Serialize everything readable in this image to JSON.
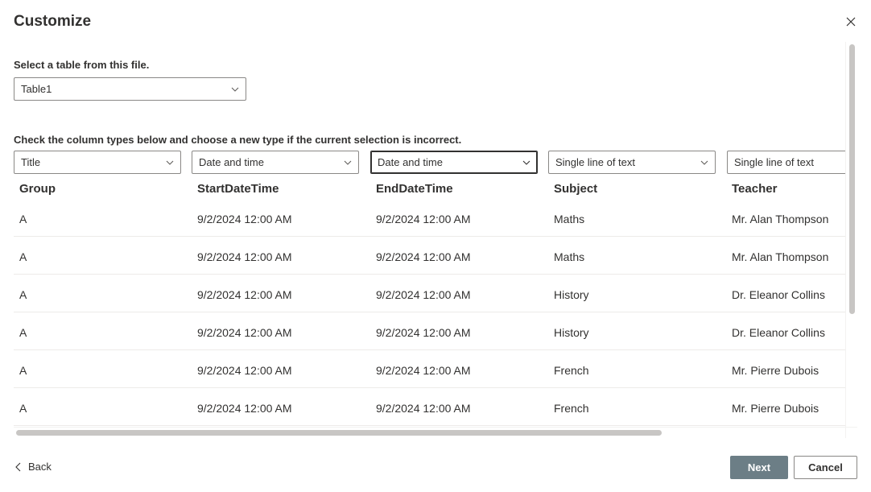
{
  "dialog": {
    "title": "Customize",
    "close_icon": "close-icon"
  },
  "table_picker": {
    "label": "Select a table from this file.",
    "selected": "Table1"
  },
  "columns_section": {
    "label": "Check the column types below and choose a new type if the current selection is incorrect."
  },
  "columns": [
    {
      "header": "Group",
      "type": "Title"
    },
    {
      "header": "StartDateTime",
      "type": "Date and time"
    },
    {
      "header": "EndDateTime",
      "type": "Date and time"
    },
    {
      "header": "Subject",
      "type": "Single line of text"
    },
    {
      "header": "Teacher",
      "type": "Single line of text"
    }
  ],
  "rows": [
    [
      "A",
      "9/2/2024 12:00 AM",
      "9/2/2024 12:00 AM",
      "Maths",
      "Mr. Alan Thompson"
    ],
    [
      "A",
      "9/2/2024 12:00 AM",
      "9/2/2024 12:00 AM",
      "Maths",
      "Mr. Alan Thompson"
    ],
    [
      "A",
      "9/2/2024 12:00 AM",
      "9/2/2024 12:00 AM",
      "History",
      "Dr. Eleanor Collins"
    ],
    [
      "A",
      "9/2/2024 12:00 AM",
      "9/2/2024 12:00 AM",
      "History",
      "Dr. Eleanor Collins"
    ],
    [
      "A",
      "9/2/2024 12:00 AM",
      "9/2/2024 12:00 AM",
      "French",
      "Mr. Pierre Dubois"
    ],
    [
      "A",
      "9/2/2024 12:00 AM",
      "9/2/2024 12:00 AM",
      "French",
      "Mr. Pierre Dubois"
    ]
  ],
  "footer": {
    "back_label": "Back",
    "next_label": "Next",
    "cancel_label": "Cancel"
  },
  "colors": {
    "primary_disabled": "#6c7e86",
    "text": "#323130",
    "border": "#8a8886"
  }
}
